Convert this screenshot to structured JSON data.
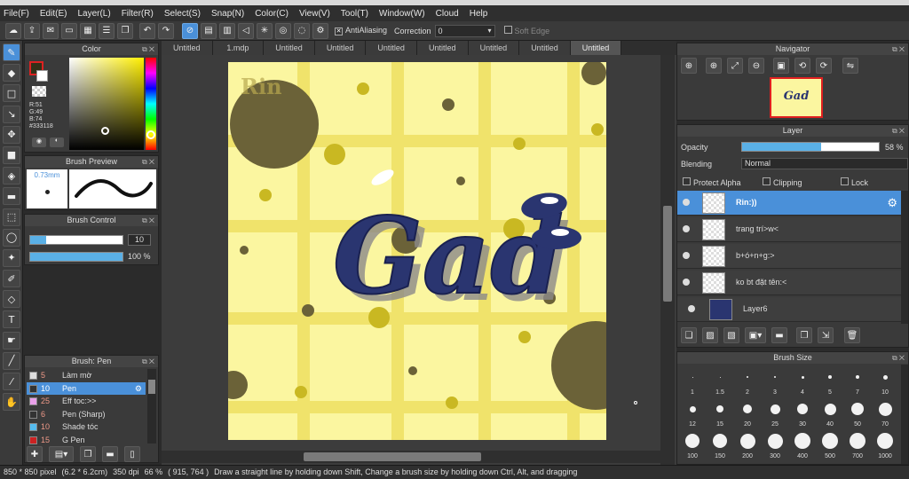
{
  "menu": [
    "File(F)",
    "Edit(E)",
    "Layer(L)",
    "Filter(R)",
    "Select(S)",
    "Snap(N)",
    "Color(C)",
    "View(V)",
    "Tool(T)",
    "Window(W)",
    "Cloud",
    "Help"
  ],
  "toolbar": {
    "antialiasing": "AntiAliasing",
    "correction_label": "Correction",
    "correction_value": "0",
    "soft_edge": "Soft Edge"
  },
  "tabs": [
    "Untitled",
    "1.mdp",
    "Untitled",
    "Untitled",
    "Untitled",
    "Untitled",
    "Untitled",
    "Untitled",
    "Untitled"
  ],
  "color_panel": {
    "title": "Color",
    "r": "R:51",
    "g": "G:49",
    "b": "B:74",
    "hex": "#333118"
  },
  "brush_preview": {
    "title": "Brush Preview",
    "size": "0.73mm"
  },
  "brush_control": {
    "title": "Brush Control",
    "size_value": "10",
    "opacity_value": "100 %"
  },
  "brush_list": {
    "title": "Brush: Pen",
    "items": [
      {
        "num": "5",
        "name": "Làm mờ",
        "color": "#dddddd"
      },
      {
        "num": "10",
        "name": "Pen",
        "color": "#333333",
        "selected": true
      },
      {
        "num": "25",
        "name": "Eff toc:>>",
        "color": "#e9a0e9"
      },
      {
        "num": "6",
        "name": "Pen (Sharp)",
        "color": "#333333"
      },
      {
        "num": "10",
        "name": "Shade tóc",
        "color": "#55bbee"
      },
      {
        "num": "15",
        "name": "G Pen",
        "color": "#cc2222"
      }
    ]
  },
  "artwork": {
    "signature": "Rin",
    "word": "Gad"
  },
  "navigator": {
    "title": "Navigator"
  },
  "layer_panel": {
    "title": "Layer",
    "opacity_label": "Opacity",
    "opacity_value": "58 %",
    "opacity_fraction": 0.58,
    "blending_label": "Blending",
    "blending_value": "Normal",
    "protect_alpha": "Protect Alpha",
    "clipping": "Clipping",
    "lock": "Lock",
    "layers": [
      {
        "name": "Rin:))",
        "selected": true
      },
      {
        "name": "trang trí>w<"
      },
      {
        "name": "b+ó+n+g:>"
      },
      {
        "name": "ko bt đặt tên:<"
      },
      {
        "name": "Layer6",
        "indent": true
      }
    ]
  },
  "brush_size": {
    "title": "Brush Size",
    "sizes": [
      "1",
      "1.5",
      "2",
      "3",
      "4",
      "5",
      "7",
      "10",
      "12",
      "15",
      "20",
      "25",
      "30",
      "40",
      "50",
      "70",
      "100",
      "150",
      "200",
      "300",
      "400",
      "500",
      "700",
      "1000"
    ]
  },
  "status": {
    "dimensions": "850 * 850 pixel",
    "physical": "(6.2 * 6.2cm)",
    "dpi": "350 dpi",
    "zoom": "66 %",
    "coords": "( 915, 764 )",
    "hint": "Draw a straight line by holding down Shift, Change a brush size by holding down Ctrl, Alt, and dragging"
  }
}
